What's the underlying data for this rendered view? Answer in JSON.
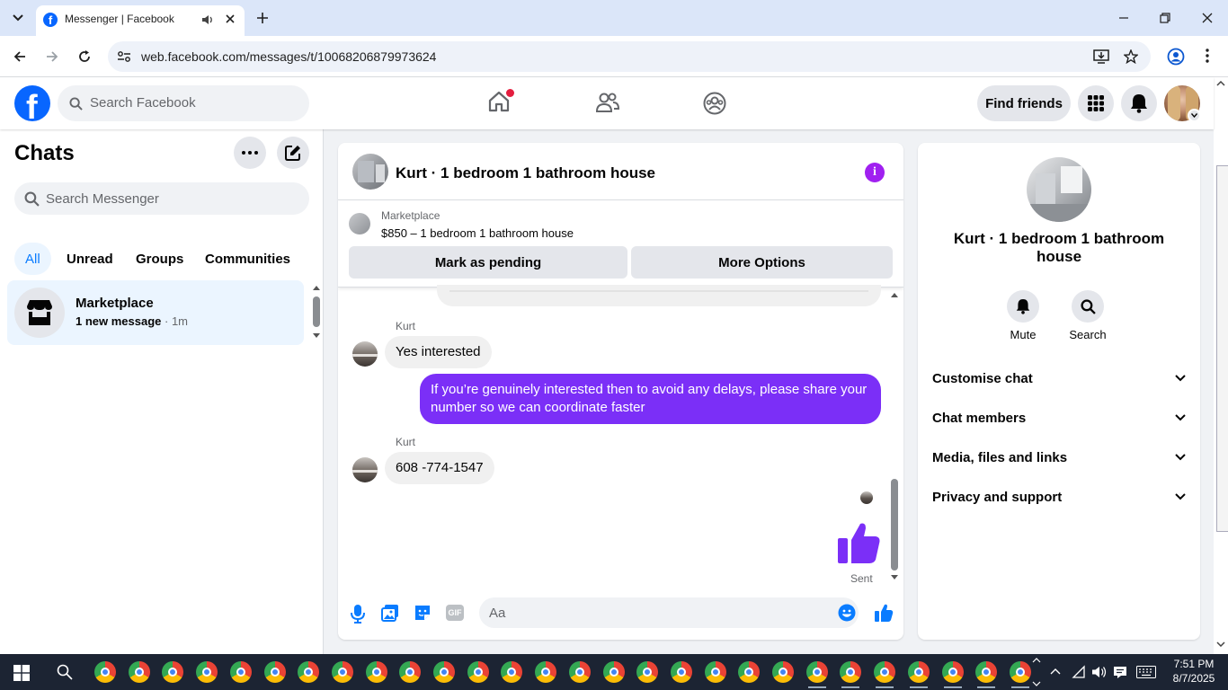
{
  "browser": {
    "tab_title": "Messenger | Facebook",
    "url": "web.facebook.com/messages/t/10068206879973624"
  },
  "fb": {
    "search_placeholder": "Search Facebook",
    "find_friends": "Find friends"
  },
  "sidebar": {
    "title": "Chats",
    "search_placeholder": "Search Messenger",
    "filters": [
      "All",
      "Unread",
      "Groups",
      "Communities"
    ],
    "chats": [
      {
        "name": "Marketplace",
        "preview": "1 new message",
        "time": "· 1m"
      }
    ]
  },
  "conversation": {
    "title": "Kurt · 1 bedroom 1 bathroom house",
    "marketplace_label": "Marketplace",
    "listing": "$850 – 1 bedroom 1 bathroom house",
    "mark_pending": "Mark as pending",
    "more_options": "More Options",
    "messages": [
      {
        "sender": "Kurt",
        "text": "Yes interested"
      },
      {
        "sender": "me",
        "text": "If you’re genuinely interested then to avoid any delays, please share your number so we can coordinate faster"
      },
      {
        "sender": "Kurt",
        "text": "608 -774-1547"
      }
    ],
    "status": "Sent",
    "composer_placeholder": "Aa"
  },
  "info_panel": {
    "name": "Kurt · 1 bedroom 1 bathroom house",
    "mute": "Mute",
    "search": "Search",
    "sections": [
      "Customise chat",
      "Chat members",
      "Media, files and links",
      "Privacy and support"
    ]
  },
  "taskbar": {
    "time": "7:51 PM",
    "date": "8/7/2025"
  },
  "colors": {
    "fb_blue": "#0866ff",
    "messenger_purple": "#7b2ff7",
    "accent_blue": "#0a7cff"
  }
}
